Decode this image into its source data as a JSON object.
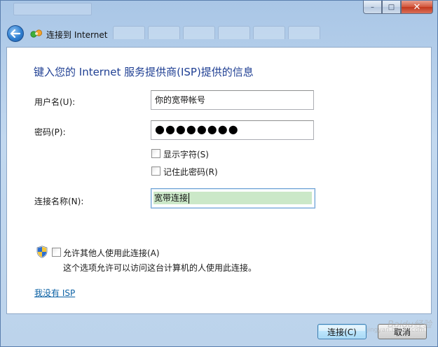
{
  "window": {
    "nav_title": "连接到 Internet"
  },
  "caption_buttons": {
    "minimize": "–",
    "maximize": "□",
    "close": "✕"
  },
  "form": {
    "heading": "键入您的 Internet 服务提供商(ISP)提供的信息",
    "username_label": "用户名(U):",
    "username_value": "你的宽带帐号",
    "password_label": "密码(P):",
    "password_value": "●●●●●●●●",
    "show_chars_label": "显示字符(S)",
    "remember_label": "记住此密码(R)",
    "conn_name_label": "连接名称(N):",
    "conn_name_value": "宽带连接",
    "allow_others_label": "允许其他人使用此连接(A)",
    "allow_others_note": "这个选项允许可以访问这台计算机的人使用此连接。",
    "no_isp_link": "我没有 ISP"
  },
  "buttons": {
    "connect": "连接(C)",
    "cancel": "取消"
  },
  "watermark": {
    "brand": "Baidu经验",
    "url": "jingyan.baidu.com"
  },
  "icons": {
    "back": "back-arrow-icon",
    "app": "network-connection-icon",
    "shield": "uac-shield-icon"
  },
  "colors": {
    "heading": "#1f3f93",
    "link": "#0b61a4",
    "selection": "#cbe8c8",
    "chrome": "#bcd3eb"
  }
}
